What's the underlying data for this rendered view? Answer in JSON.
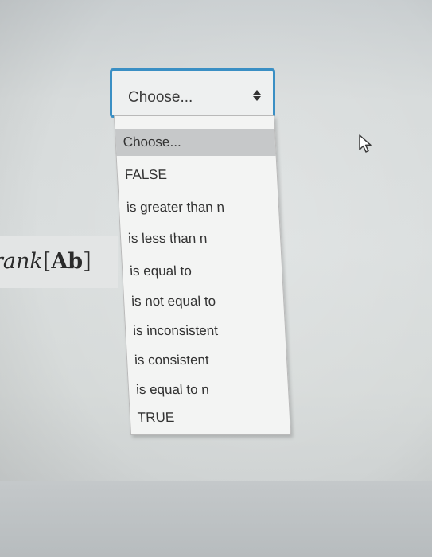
{
  "select": {
    "value": "Choose...",
    "options": [
      "Choose...",
      "FALSE",
      "is greater than n",
      "is less than n",
      "is equal to",
      "is not equal to",
      "is inconsistent",
      "is consistent",
      "is equal to n",
      "TRUE"
    ],
    "highlighted_index": 0
  },
  "expression": {
    "function": "rank",
    "open_bracket": "[",
    "argument": "Ab",
    "close_bracket": "]"
  },
  "colors": {
    "select_border": "#3a8fc4",
    "option_highlight": "#c6c8c9"
  },
  "icons": {
    "select_arrows": "up-down-chevron-icon",
    "cursor": "mouse-pointer-icon"
  }
}
